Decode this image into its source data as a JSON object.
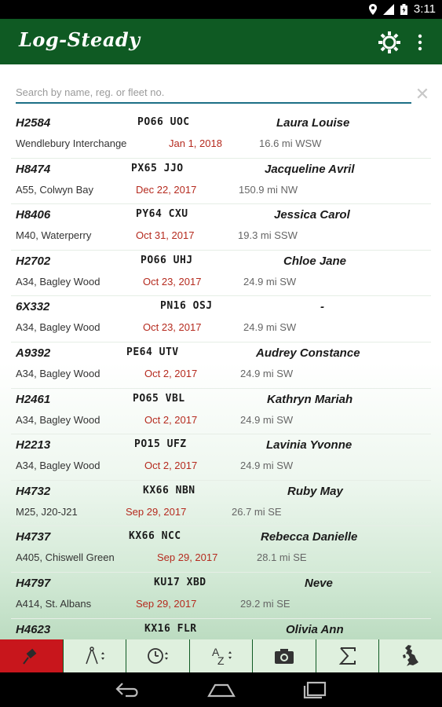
{
  "status": {
    "time": "3:11"
  },
  "app": {
    "title": "Log-Steady"
  },
  "search": {
    "placeholder": "Search by name, reg. or fleet no."
  },
  "rows": [
    {
      "fleet": "H2584",
      "reg": "PO66 UOC",
      "name": "Laura Louise",
      "location": "Wendlebury Interchange",
      "date": "Jan 1, 2018",
      "distance": "16.6 mi WSW"
    },
    {
      "fleet": "H8474",
      "reg": "PX65 JJO",
      "name": "Jacqueline Avril",
      "location": "A55, Colwyn Bay",
      "date": "Dec 22, 2017",
      "distance": "150.9 mi NW"
    },
    {
      "fleet": "H8406",
      "reg": "PY64 CXU",
      "name": "Jessica Carol",
      "location": "M40, Waterperry",
      "date": "Oct 31, 2017",
      "distance": "19.3 mi SSW"
    },
    {
      "fleet": "H2702",
      "reg": "PO66 UHJ",
      "name": "Chloe Jane",
      "location": "A34, Bagley Wood",
      "date": "Oct 23, 2017",
      "distance": "24.9 mi SW"
    },
    {
      "fleet": "6X332",
      "reg": "PN16 OSJ",
      "name": "-",
      "location": "A34, Bagley Wood",
      "date": "Oct 23, 2017",
      "distance": "24.9 mi SW"
    },
    {
      "fleet": "A9392",
      "reg": "PE64 UTV",
      "name": "Audrey Constance",
      "location": "A34, Bagley Wood",
      "date": "Oct 2, 2017",
      "distance": "24.9 mi SW"
    },
    {
      "fleet": "H2461",
      "reg": "PO65 VBL",
      "name": "Kathryn Mariah",
      "location": "A34, Bagley Wood",
      "date": "Oct 2, 2017",
      "distance": "24.9 mi SW"
    },
    {
      "fleet": "H2213",
      "reg": "PO15 UFZ",
      "name": "Lavinia Yvonne",
      "location": "A34, Bagley Wood",
      "date": "Oct 2, 2017",
      "distance": "24.9 mi SW"
    },
    {
      "fleet": "H4732",
      "reg": "KX66 NBN",
      "name": "Ruby May",
      "location": "M25, J20-J21",
      "date": "Sep 29, 2017",
      "distance": "26.7 mi SE"
    },
    {
      "fleet": "H4737",
      "reg": "KX66 NCC",
      "name": "Rebecca Danielle",
      "location": "A405, Chiswell Green",
      "date": "Sep 29, 2017",
      "distance": "28.1 mi SE"
    },
    {
      "fleet": "H4797",
      "reg": "KU17 XBD",
      "name": "Neve",
      "location": "A414, St. Albans",
      "date": "Sep 29, 2017",
      "distance": "29.2 mi SE"
    },
    {
      "fleet": "H4623",
      "reg": "KX16 FLR",
      "name": "Olivia Ann",
      "location": "",
      "date": "",
      "distance": ""
    }
  ],
  "colors": {
    "appbar": "#0f5a23",
    "date": "#b52a1e",
    "active_tab": "#c8161c",
    "tab_bg": "#dff0de",
    "search_line": "#1d6f86"
  },
  "bottom_tabs": [
    {
      "icon": "map-pin-icon",
      "active": true
    },
    {
      "icon": "compass-sort-icon",
      "active": false
    },
    {
      "icon": "clock-sort-icon",
      "active": false
    },
    {
      "icon": "az-sort-icon",
      "active": false
    },
    {
      "icon": "camera-icon",
      "active": false
    },
    {
      "icon": "sigma-icon",
      "active": false
    },
    {
      "icon": "uk-map-icon",
      "active": false
    }
  ]
}
